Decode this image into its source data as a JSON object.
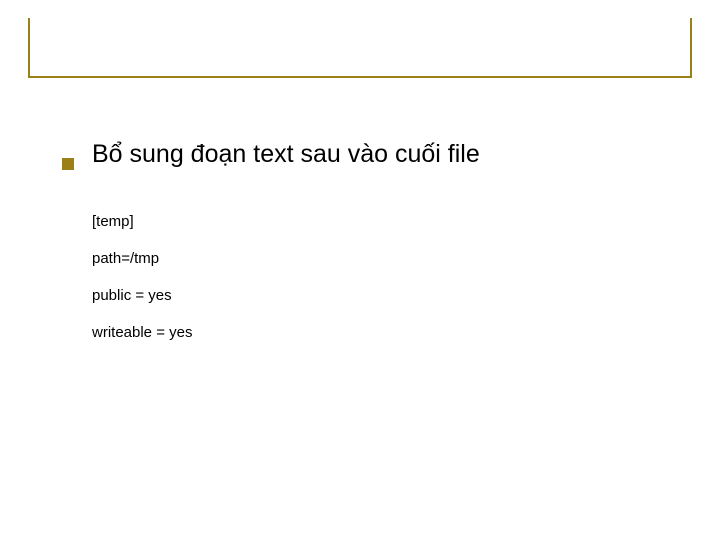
{
  "bullet": {
    "text": "Bổ sung đoạn text sau vào cuối file"
  },
  "code": {
    "line1": "[temp]",
    "line2": "path=/tmp",
    "line3": "public = yes",
    "line4": "writeable = yes"
  }
}
